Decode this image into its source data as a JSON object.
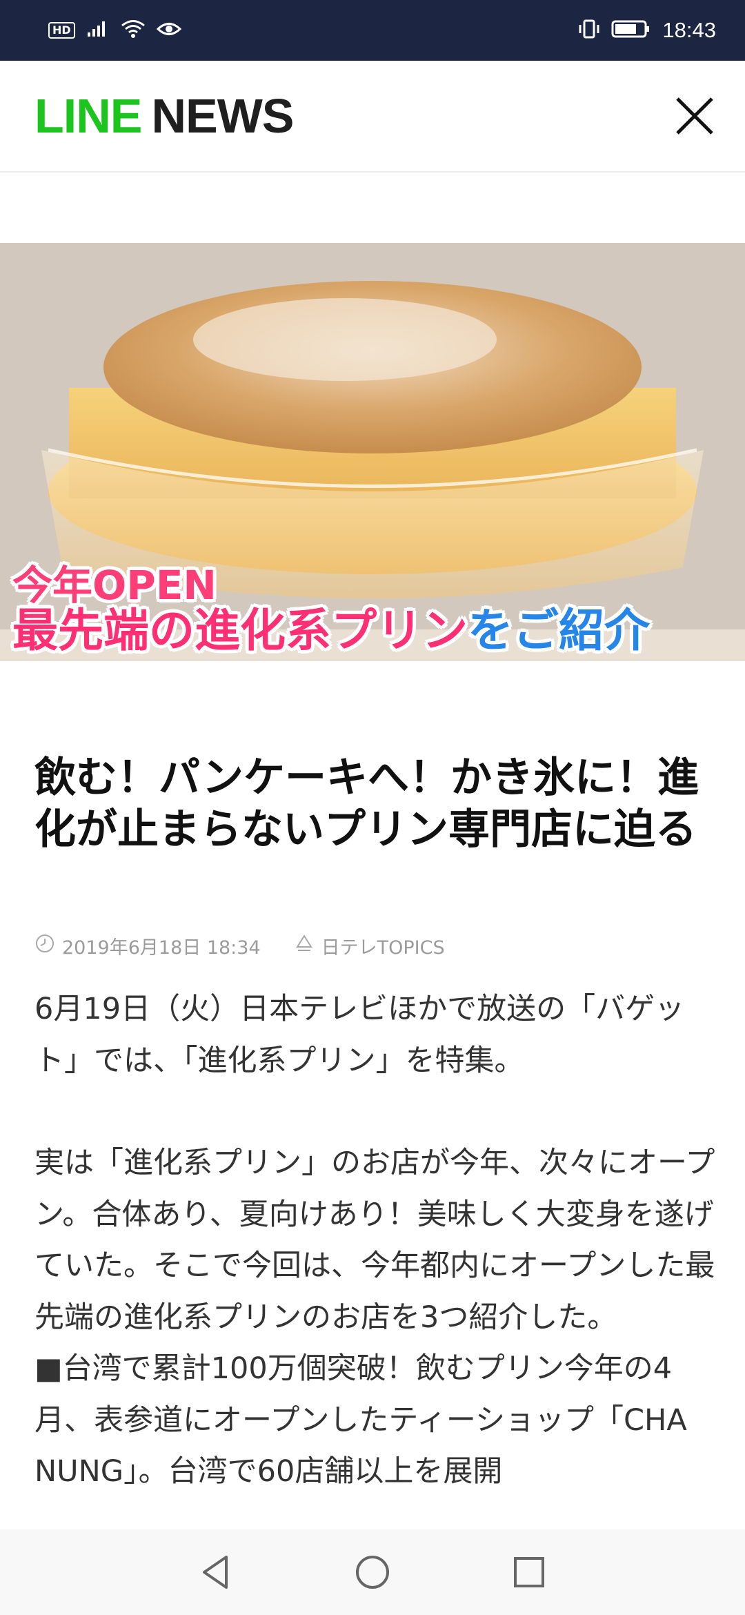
{
  "status_bar": {
    "hd_label": "HD",
    "time": "18:43",
    "icons": [
      "signal-icon",
      "wifi-icon",
      "eye-icon",
      "vibrate-icon",
      "battery-icon"
    ]
  },
  "header": {
    "logo_line": "LINE",
    "logo_news": "NEWS",
    "logo_color": "#1bc51d",
    "close_icon": "close-icon"
  },
  "hero": {
    "caption_line1": "今年OPEN",
    "caption_line2_part1": "最先端の進化系プリン",
    "caption_line2_part2": "をご紹介"
  },
  "article": {
    "title": "飲む！パンケーキへ！かき氷に！進化が止まらないプリン専門店に迫る",
    "date": "2019年6月18日 18:34",
    "source": "日テレTOPICS",
    "paragraphs": [
      "6月19日（火）日本テレビほかで放送の「バゲット」では、「進化系プリン」を特集。",
      "実は「進化系プリン」のお店が今年、次々にオープン。合体あり、夏向けあり！美味しく大変身を遂げていた。そこで今回は、今年都内にオープンした最先端の進化系プリンのお店を3つ紹介した。",
      "■台湾で累計100万個突破！飲むプリン今年の4月、表参道にオープンしたティーショップ「CHA NUNG」。台湾で60店舗以上を展開"
    ]
  },
  "nav": {
    "back": "back-icon",
    "home": "home-icon",
    "recents": "recents-icon"
  }
}
